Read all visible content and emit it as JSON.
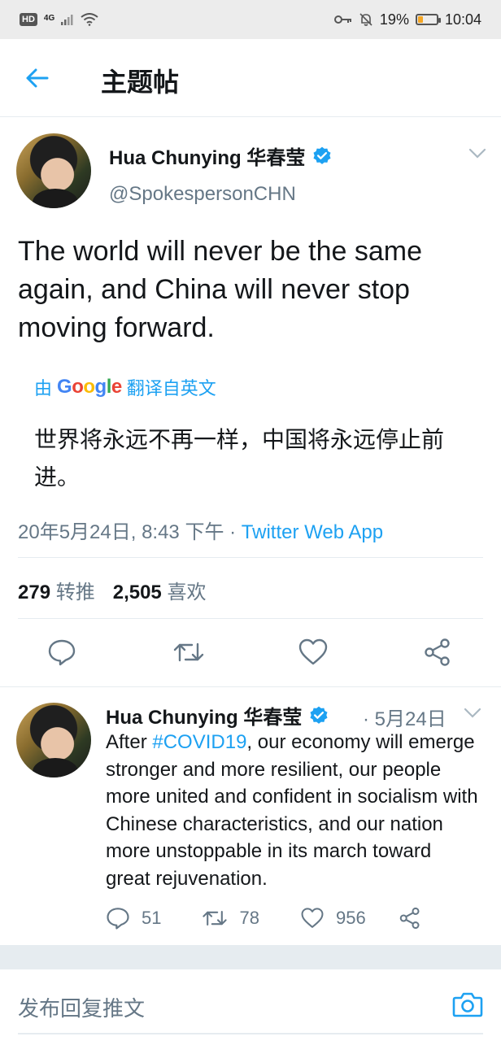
{
  "status_bar": {
    "hd_badge": "HD",
    "network": "4G",
    "battery_percent": "19%",
    "battery_level": 0.19,
    "time": "10:04"
  },
  "header": {
    "title": "主题帖"
  },
  "main_tweet": {
    "author_name": "Hua Chunying 华春莹",
    "handle": "@SpokespersonCHN",
    "text": "The world will never be the same again, and China will never stop moving forward.",
    "translated_by_prefix": "由",
    "translated_by_suffix": "翻译自英文",
    "translation": "世界将永远不再一样，中国将永远停止前进。",
    "timestamp": "20年5月24日, 8:43 下午 · ",
    "source_app": "Twitter Web App",
    "retweets_count": "279",
    "retweets_label": "转推",
    "likes_count": "2,505",
    "likes_label": "喜欢"
  },
  "reply_tweet": {
    "author_name": "Hua Chunying 华春莹",
    "date": "· 5月24日",
    "text_before": "After ",
    "hashtag": "#COVID19",
    "text_after": ", our economy will emerge stronger and more resilient, our people more united and confident in socialism with Chinese characteristics, and our nation more unstoppable in its march toward great rejuvenation.",
    "replies": "51",
    "retweets": "78",
    "likes": "956"
  },
  "composer": {
    "placeholder": "发布回复推文"
  },
  "colors": {
    "accent": "#1da1f2",
    "text": "#14171a",
    "muted": "#657786",
    "status_bar_bg": "#ececec",
    "battery_fill": "#f5a623"
  },
  "icons": [
    "hd-icon",
    "signal-icon",
    "wifi-icon",
    "key-icon",
    "mute-bell-icon",
    "battery-icon",
    "back-arrow-icon",
    "verified-badge-icon",
    "chevron-down-icon",
    "reply-icon",
    "retweet-icon",
    "like-icon",
    "share-icon",
    "camera-icon"
  ]
}
